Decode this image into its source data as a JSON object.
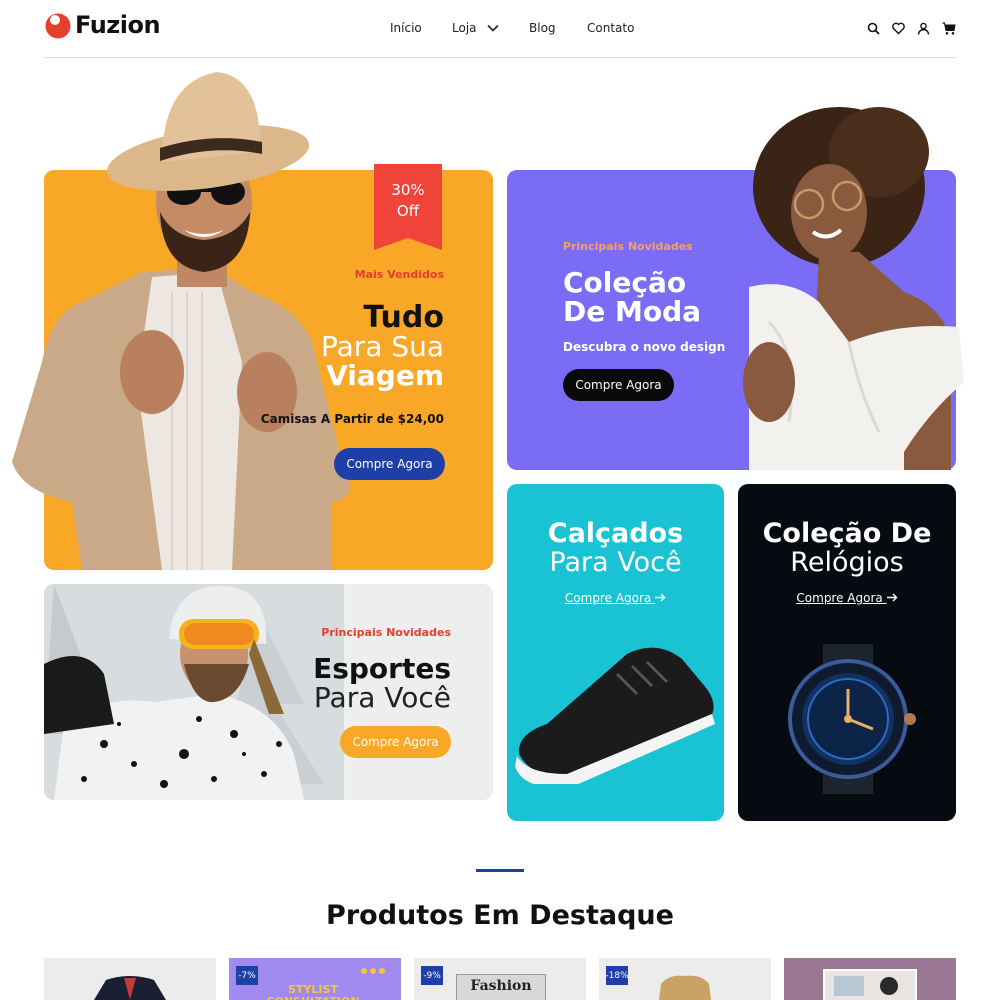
{
  "brand": {
    "name": "Fuzion",
    "accent": "#e4402b"
  },
  "nav": {
    "items": [
      "Início",
      "Loja",
      "Blog",
      "Contato"
    ]
  },
  "header_icons": [
    "search-icon",
    "heart-icon",
    "user-icon",
    "cart-icon"
  ],
  "hero_travel": {
    "badge_line1": "30%",
    "badge_line2": "Off",
    "eyebrow": "Mais Vendidos",
    "title_line1": "Tudo",
    "title_line2": "Para Sua",
    "title_line3": "Viagem",
    "subtitle": "Camisas A Partir de $24,00",
    "button": "Compre Agora",
    "color": "#f8a826"
  },
  "hero_fashion": {
    "eyebrow": "Principais Novidades",
    "title_line1": "Coleção",
    "title_line2": "De Moda",
    "subtitle": "Descubra o novo design",
    "button": "Compre Agora",
    "color": "#7b6cf6"
  },
  "banner_sports": {
    "eyebrow": "Principais Novidades",
    "title_line1": "Esportes",
    "title_line2": "Para Você",
    "button": "Compre Agora"
  },
  "banner_shoes": {
    "title_line1": "Calçados",
    "title_line2": "Para Você",
    "link": "Compre Agora",
    "color": "#19c3d4"
  },
  "banner_watches": {
    "title_line1": "Coleção De",
    "title_line2": "Relógios",
    "link": "Compre Agora",
    "color": "#060b12"
  },
  "featured": {
    "title": "Produtos Em Destaque",
    "products": [
      {
        "discount": ""
      },
      {
        "discount": "-7%",
        "image_text": "STYLIST CONSULTATION"
      },
      {
        "discount": "-9%",
        "image_text": "Fashion"
      },
      {
        "discount": "-18%"
      },
      {
        "discount": ""
      }
    ]
  }
}
